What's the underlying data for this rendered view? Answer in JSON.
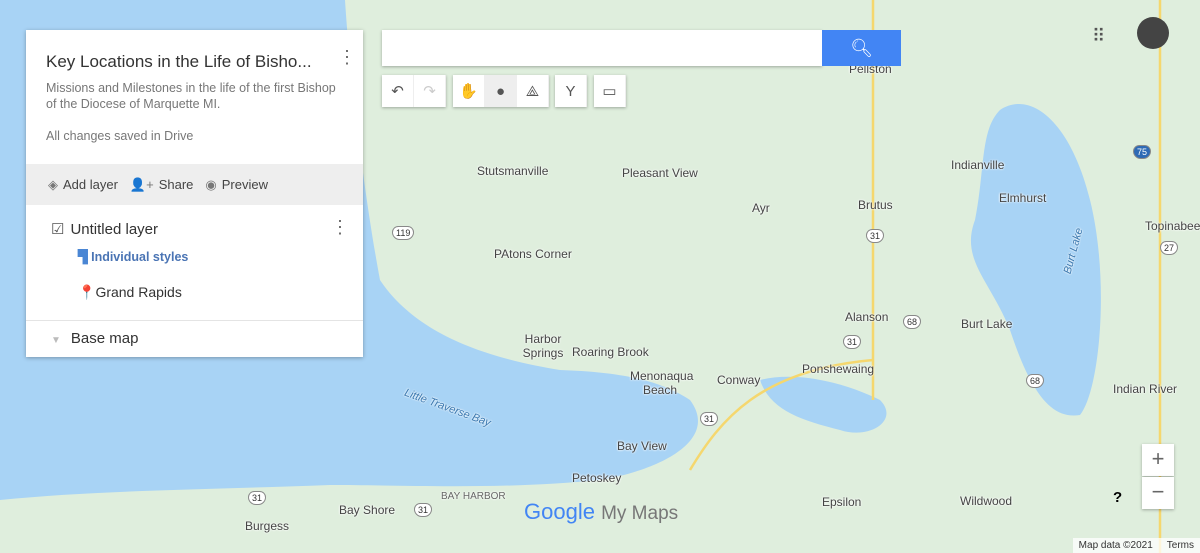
{
  "panel": {
    "title": "Key Locations in the Life of Bisho...",
    "description": "Missions and Milestones in the life of the first Bishop of the Diocese of Marquette MI.",
    "status": "All changes saved in Drive",
    "actions": {
      "add_layer": "Add layer",
      "share": "Share",
      "preview": "Preview"
    },
    "layer": {
      "name": "Untitled layer",
      "checked": true,
      "styles": "Individual styles",
      "places": [
        "Grand Rapids"
      ]
    },
    "base_map": "Base map"
  },
  "search": {
    "value": "",
    "placeholder": ""
  },
  "toolbar": [
    "undo-icon",
    "redo-icon",
    "hand-icon",
    "marker-icon",
    "line-icon",
    "directions-icon",
    "ruler-icon"
  ],
  "map": {
    "labels": [
      "Stutsmanville",
      "Pleasant View",
      "Ayr",
      "Brutus",
      "Indianville",
      "Elmhurst",
      "Topinabee",
      "PAtons Corner",
      "Alanson",
      "Burt Lake",
      "Harbor Springs",
      "Roaring Brook",
      "Menonaqua Beach",
      "Conway",
      "Ponshewaing",
      "Indian River",
      "Little Traverse Bay",
      "Bay View",
      "Petoskey",
      "BAY HARBOR",
      "Bay Shore",
      "Burgess",
      "Epsilon",
      "Wildwood",
      "Pellston",
      "Burt Lake"
    ],
    "routes": [
      "119",
      "31",
      "31",
      "68",
      "68",
      "31",
      "31",
      "31",
      "27",
      "75"
    ]
  },
  "logo": {
    "google": "Google",
    "product": "My Maps"
  },
  "footer": {
    "map_data": "Map data ©2021",
    "terms": "Terms"
  },
  "colors": {
    "water": "#a8d3f5",
    "land": "#dfeedd",
    "accent": "#4285f4"
  }
}
